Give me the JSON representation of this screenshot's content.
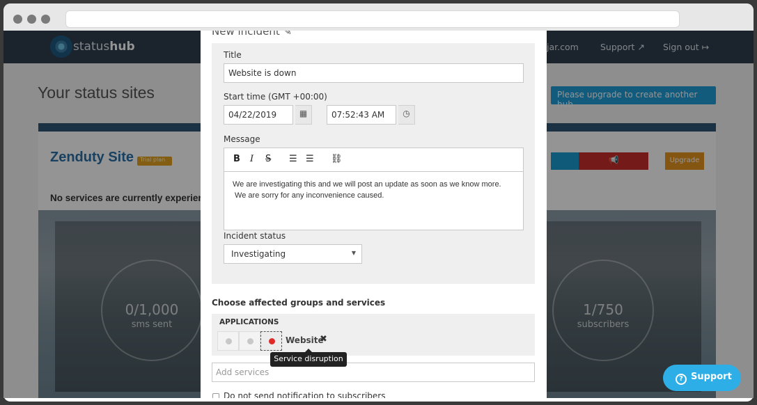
{
  "navbar": {
    "brand_prefix": "status",
    "brand_suffix": "hub",
    "link_domain": "jar.com",
    "link_support": "Support",
    "link_signout": "Sign out"
  },
  "page": {
    "title": "Your status sites",
    "upgrade_banner": "Please upgrade to create another hub"
  },
  "site": {
    "name": "Zenduty Site",
    "badge": "Trial plan",
    "upgrade_button": "Upgrade",
    "no_services": "No services are currently experien",
    "stats": [
      {
        "value": "0/1,000",
        "label": "sms sent"
      },
      {
        "value": "1/750",
        "label": "subscribers"
      }
    ]
  },
  "modal": {
    "heading": "New incident",
    "title_label": "Title",
    "title_value": "Website is down",
    "start_label": "Start time (GMT +00:00)",
    "date_value": "04/22/2019",
    "time_value": "07:52:43 AM",
    "message_label": "Message",
    "message_text": "We are investigating this and we will post an update as soon as we know more.\n We are sorry for any inconvenience caused.",
    "status_label": "Incident status",
    "status_value": "Investigating",
    "groups_title": "Choose affected groups and services",
    "apps_title": "APPLICATIONS",
    "service_name": "Website",
    "tooltip": "Service disruption",
    "add_placeholder": "Add services",
    "no_notify_label": "Do not send notification to subscribers"
  },
  "support_widget": {
    "label": "Support"
  },
  "colors": {
    "navbar": "#2f3e4d",
    "accent_blue": "#1f9ed6",
    "danger_red": "#e02a2a",
    "warning_orange": "#e6951f"
  }
}
